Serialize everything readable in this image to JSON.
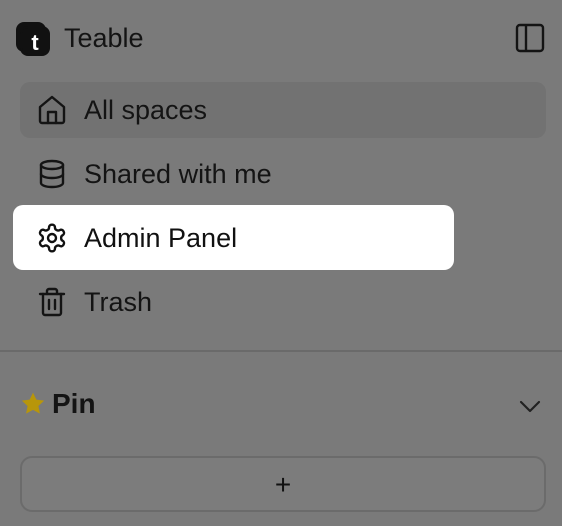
{
  "header": {
    "app_name": "Teable",
    "logo_letter": "t",
    "toggle_icon": "sidebar-toggle-icon"
  },
  "nav": {
    "items": [
      {
        "label": "All spaces",
        "icon": "home-icon",
        "active": true
      },
      {
        "label": "Shared with me",
        "icon": "database-icon",
        "active": false
      },
      {
        "label": "Admin Panel",
        "icon": "gear-icon",
        "highlighted": true
      },
      {
        "label": "Trash",
        "icon": "trash-icon",
        "active": false
      }
    ]
  },
  "pin": {
    "label": "Pin",
    "icon": "star-icon",
    "star_color": "#b8960a",
    "chevron": "chevron-down-icon"
  },
  "add_button": {
    "label": "+"
  },
  "colors": {
    "overlay_background": "#7a7a7a",
    "active_item": "#727272",
    "highlight": "#ffffff",
    "text": "#141414"
  }
}
